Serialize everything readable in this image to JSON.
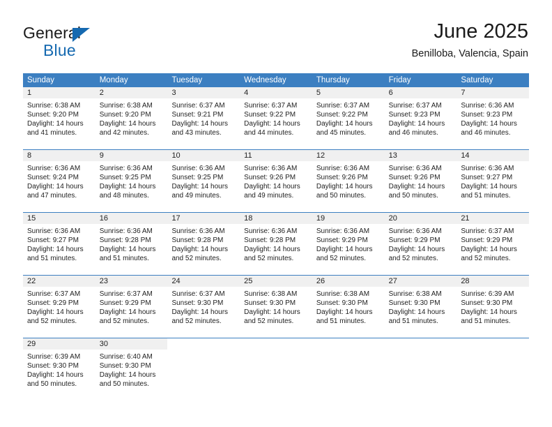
{
  "brand": {
    "word1": "General",
    "word2": "Blue",
    "accent_color": "#1569b0"
  },
  "header": {
    "title": "June 2025",
    "subtitle": "Benilloba, Valencia, Spain"
  },
  "calendar": {
    "header_bg": "#3c7fc1",
    "day_band_bg": "#f0f0f0",
    "weekdays": [
      "Sunday",
      "Monday",
      "Tuesday",
      "Wednesday",
      "Thursday",
      "Friday",
      "Saturday"
    ],
    "weeks": [
      [
        {
          "day": "1",
          "sunrise": "Sunrise: 6:38 AM",
          "sunset": "Sunset: 9:20 PM",
          "daylight_line1": "Daylight: 14 hours",
          "daylight_line2": "and 41 minutes."
        },
        {
          "day": "2",
          "sunrise": "Sunrise: 6:38 AM",
          "sunset": "Sunset: 9:20 PM",
          "daylight_line1": "Daylight: 14 hours",
          "daylight_line2": "and 42 minutes."
        },
        {
          "day": "3",
          "sunrise": "Sunrise: 6:37 AM",
          "sunset": "Sunset: 9:21 PM",
          "daylight_line1": "Daylight: 14 hours",
          "daylight_line2": "and 43 minutes."
        },
        {
          "day": "4",
          "sunrise": "Sunrise: 6:37 AM",
          "sunset": "Sunset: 9:22 PM",
          "daylight_line1": "Daylight: 14 hours",
          "daylight_line2": "and 44 minutes."
        },
        {
          "day": "5",
          "sunrise": "Sunrise: 6:37 AM",
          "sunset": "Sunset: 9:22 PM",
          "daylight_line1": "Daylight: 14 hours",
          "daylight_line2": "and 45 minutes."
        },
        {
          "day": "6",
          "sunrise": "Sunrise: 6:37 AM",
          "sunset": "Sunset: 9:23 PM",
          "daylight_line1": "Daylight: 14 hours",
          "daylight_line2": "and 46 minutes."
        },
        {
          "day": "7",
          "sunrise": "Sunrise: 6:36 AM",
          "sunset": "Sunset: 9:23 PM",
          "daylight_line1": "Daylight: 14 hours",
          "daylight_line2": "and 46 minutes."
        }
      ],
      [
        {
          "day": "8",
          "sunrise": "Sunrise: 6:36 AM",
          "sunset": "Sunset: 9:24 PM",
          "daylight_line1": "Daylight: 14 hours",
          "daylight_line2": "and 47 minutes."
        },
        {
          "day": "9",
          "sunrise": "Sunrise: 6:36 AM",
          "sunset": "Sunset: 9:25 PM",
          "daylight_line1": "Daylight: 14 hours",
          "daylight_line2": "and 48 minutes."
        },
        {
          "day": "10",
          "sunrise": "Sunrise: 6:36 AM",
          "sunset": "Sunset: 9:25 PM",
          "daylight_line1": "Daylight: 14 hours",
          "daylight_line2": "and 49 minutes."
        },
        {
          "day": "11",
          "sunrise": "Sunrise: 6:36 AM",
          "sunset": "Sunset: 9:26 PM",
          "daylight_line1": "Daylight: 14 hours",
          "daylight_line2": "and 49 minutes."
        },
        {
          "day": "12",
          "sunrise": "Sunrise: 6:36 AM",
          "sunset": "Sunset: 9:26 PM",
          "daylight_line1": "Daylight: 14 hours",
          "daylight_line2": "and 50 minutes."
        },
        {
          "day": "13",
          "sunrise": "Sunrise: 6:36 AM",
          "sunset": "Sunset: 9:26 PM",
          "daylight_line1": "Daylight: 14 hours",
          "daylight_line2": "and 50 minutes."
        },
        {
          "day": "14",
          "sunrise": "Sunrise: 6:36 AM",
          "sunset": "Sunset: 9:27 PM",
          "daylight_line1": "Daylight: 14 hours",
          "daylight_line2": "and 51 minutes."
        }
      ],
      [
        {
          "day": "15",
          "sunrise": "Sunrise: 6:36 AM",
          "sunset": "Sunset: 9:27 PM",
          "daylight_line1": "Daylight: 14 hours",
          "daylight_line2": "and 51 minutes."
        },
        {
          "day": "16",
          "sunrise": "Sunrise: 6:36 AM",
          "sunset": "Sunset: 9:28 PM",
          "daylight_line1": "Daylight: 14 hours",
          "daylight_line2": "and 51 minutes."
        },
        {
          "day": "17",
          "sunrise": "Sunrise: 6:36 AM",
          "sunset": "Sunset: 9:28 PM",
          "daylight_line1": "Daylight: 14 hours",
          "daylight_line2": "and 52 minutes."
        },
        {
          "day": "18",
          "sunrise": "Sunrise: 6:36 AM",
          "sunset": "Sunset: 9:28 PM",
          "daylight_line1": "Daylight: 14 hours",
          "daylight_line2": "and 52 minutes."
        },
        {
          "day": "19",
          "sunrise": "Sunrise: 6:36 AM",
          "sunset": "Sunset: 9:29 PM",
          "daylight_line1": "Daylight: 14 hours",
          "daylight_line2": "and 52 minutes."
        },
        {
          "day": "20",
          "sunrise": "Sunrise: 6:36 AM",
          "sunset": "Sunset: 9:29 PM",
          "daylight_line1": "Daylight: 14 hours",
          "daylight_line2": "and 52 minutes."
        },
        {
          "day": "21",
          "sunrise": "Sunrise: 6:37 AM",
          "sunset": "Sunset: 9:29 PM",
          "daylight_line1": "Daylight: 14 hours",
          "daylight_line2": "and 52 minutes."
        }
      ],
      [
        {
          "day": "22",
          "sunrise": "Sunrise: 6:37 AM",
          "sunset": "Sunset: 9:29 PM",
          "daylight_line1": "Daylight: 14 hours",
          "daylight_line2": "and 52 minutes."
        },
        {
          "day": "23",
          "sunrise": "Sunrise: 6:37 AM",
          "sunset": "Sunset: 9:29 PM",
          "daylight_line1": "Daylight: 14 hours",
          "daylight_line2": "and 52 minutes."
        },
        {
          "day": "24",
          "sunrise": "Sunrise: 6:37 AM",
          "sunset": "Sunset: 9:30 PM",
          "daylight_line1": "Daylight: 14 hours",
          "daylight_line2": "and 52 minutes."
        },
        {
          "day": "25",
          "sunrise": "Sunrise: 6:38 AM",
          "sunset": "Sunset: 9:30 PM",
          "daylight_line1": "Daylight: 14 hours",
          "daylight_line2": "and 52 minutes."
        },
        {
          "day": "26",
          "sunrise": "Sunrise: 6:38 AM",
          "sunset": "Sunset: 9:30 PM",
          "daylight_line1": "Daylight: 14 hours",
          "daylight_line2": "and 51 minutes."
        },
        {
          "day": "27",
          "sunrise": "Sunrise: 6:38 AM",
          "sunset": "Sunset: 9:30 PM",
          "daylight_line1": "Daylight: 14 hours",
          "daylight_line2": "and 51 minutes."
        },
        {
          "day": "28",
          "sunrise": "Sunrise: 6:39 AM",
          "sunset": "Sunset: 9:30 PM",
          "daylight_line1": "Daylight: 14 hours",
          "daylight_line2": "and 51 minutes."
        }
      ],
      [
        {
          "day": "29",
          "sunrise": "Sunrise: 6:39 AM",
          "sunset": "Sunset: 9:30 PM",
          "daylight_line1": "Daylight: 14 hours",
          "daylight_line2": "and 50 minutes."
        },
        {
          "day": "30",
          "sunrise": "Sunrise: 6:40 AM",
          "sunset": "Sunset: 9:30 PM",
          "daylight_line1": "Daylight: 14 hours",
          "daylight_line2": "and 50 minutes."
        },
        {
          "day": "",
          "sunrise": "",
          "sunset": "",
          "daylight_line1": "",
          "daylight_line2": ""
        },
        {
          "day": "",
          "sunrise": "",
          "sunset": "",
          "daylight_line1": "",
          "daylight_line2": ""
        },
        {
          "day": "",
          "sunrise": "",
          "sunset": "",
          "daylight_line1": "",
          "daylight_line2": ""
        },
        {
          "day": "",
          "sunrise": "",
          "sunset": "",
          "daylight_line1": "",
          "daylight_line2": ""
        },
        {
          "day": "",
          "sunrise": "",
          "sunset": "",
          "daylight_line1": "",
          "daylight_line2": ""
        }
      ]
    ]
  }
}
